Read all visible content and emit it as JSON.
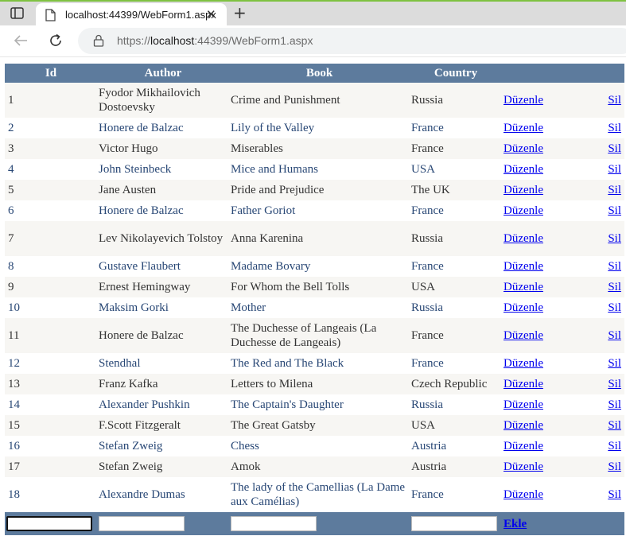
{
  "browser": {
    "tab_title": "localhost:44399/WebForm1.aspx",
    "url_scheme": "https://",
    "url_host": "localhost",
    "url_rest": ":44399/WebForm1.aspx"
  },
  "grid": {
    "headers": {
      "id": "Id",
      "author": "Author",
      "book": "Book",
      "country": "Country"
    },
    "rows": [
      {
        "id": "1",
        "author": "Fyodor Mikhailovich Dostoevsky",
        "book": "Crime and Punishment",
        "country": "Russia"
      },
      {
        "id": "2",
        "author": "Honere de Balzac",
        "book": "Lily of the Valley",
        "country": "France"
      },
      {
        "id": "3",
        "author": "Victor Hugo",
        "book": "Miserables",
        "country": "France"
      },
      {
        "id": "4",
        "author": "John Steinbeck",
        "book": "Mice and Humans",
        "country": "USA"
      },
      {
        "id": "5",
        "author": "Jane Austen",
        "book": "Pride and Prejudice",
        "country": "The UK"
      },
      {
        "id": "6",
        "author": "Honere de Balzac",
        "book": "Father Goriot",
        "country": "France"
      },
      {
        "id": "7",
        "author": "Lev Nikolayevich Tolstoy",
        "book": "Anna Karenina",
        "country": "Russia"
      },
      {
        "id": "8",
        "author": "Gustave Flaubert",
        "book": "Madame Bovary",
        "country": "France"
      },
      {
        "id": "9",
        "author": "Ernest Hemingway",
        "book": "For Whom the Bell Tolls",
        "country": "USA"
      },
      {
        "id": "10",
        "author": "Maksim Gorki",
        "book": "Mother",
        "country": "Russia"
      },
      {
        "id": "11",
        "author": "Honere de Balzac",
        "book": "The Duchesse of Langeais (La Duchesse de Langeais)",
        "country": "France"
      },
      {
        "id": "12",
        "author": "Stendhal",
        "book": "The Red and The Black",
        "country": "France"
      },
      {
        "id": "13",
        "author": "Franz Kafka",
        "book": "Letters to Milena",
        "country": "Czech Republic"
      },
      {
        "id": "14",
        "author": "Alexander Pushkin",
        "book": "The Captain's Daughter",
        "country": "Russia"
      },
      {
        "id": "15",
        "author": "F.Scott Fitzgeralt",
        "book": "The Great Gatsby",
        "country": "USA"
      },
      {
        "id": "16",
        "author": "Stefan Zweig",
        "book": "Chess",
        "country": "Austria"
      },
      {
        "id": "17",
        "author": "Stefan Zweig",
        "book": "Amok",
        "country": "Austria"
      },
      {
        "id": "18",
        "author": "Alexandre Dumas",
        "book": "The lady of the Camellias (La Dame aux Camélias)",
        "country": "France"
      }
    ],
    "edit_label": "Düzenle",
    "delete_label": "Sil",
    "add_label": "Ekle",
    "colors": {
      "header_bg": "#5d7b9d",
      "row_alt_bg": "#f7f6f3",
      "row_bg": "#ffffff",
      "row_alt_text": "#333333",
      "row_text": "#284775",
      "link": "#0000ee"
    }
  }
}
